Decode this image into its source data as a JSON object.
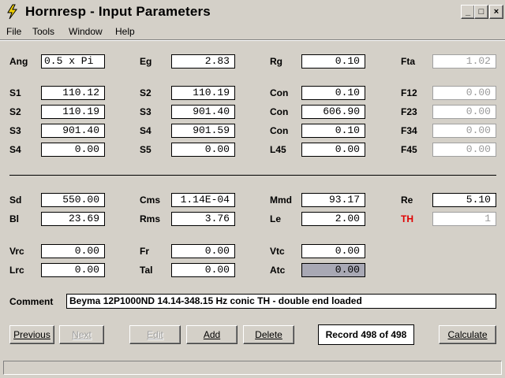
{
  "window": {
    "title": "Hornresp - Input Parameters",
    "minimize": "_",
    "maximize": "□",
    "close": "×"
  },
  "menu": [
    "File",
    "Tools",
    "Window",
    "Help"
  ],
  "params": {
    "Ang": "0.5 x Pi",
    "Eg": "2.83",
    "Rg": "0.10",
    "Fta": "1.02",
    "S1": "110.12",
    "S2a": "110.19",
    "Con1": "0.10",
    "F12": "0.00",
    "S2b": "110.19",
    "S3a": "901.40",
    "Con2": "606.90",
    "F23": "0.00",
    "S3b": "901.40",
    "S4a": "901.59",
    "Con3": "0.10",
    "F34": "0.00",
    "S4b": "0.00",
    "S5": "0.00",
    "L45": "0.00",
    "F45": "0.00",
    "Sd": "550.00",
    "Cms": "1.14E-04",
    "Mmd": "93.17",
    "Re": "5.10",
    "Bl": "23.69",
    "Rms": "3.76",
    "Le": "2.00",
    "TH": "1",
    "Vrc": "0.00",
    "Fr": "0.00",
    "Vtc": "0.00",
    "Lrc": "0.00",
    "Tal": "0.00",
    "Atc": "0.00"
  },
  "labels": {
    "Ang": "Ang",
    "Eg": "Eg",
    "Rg": "Rg",
    "Fta": "Fta",
    "S1": "S1",
    "S2": "S2",
    "S3": "S3",
    "S4": "S4",
    "S5": "S5",
    "Con": "Con",
    "L45": "L45",
    "F12": "F12",
    "F23": "F23",
    "F34": "F34",
    "F45": "F45",
    "Sd": "Sd",
    "Cms": "Cms",
    "Mmd": "Mmd",
    "Re": "Re",
    "Bl": "Bl",
    "Rms": "Rms",
    "Le": "Le",
    "TH": "TH",
    "Vrc": "Vrc",
    "Fr": "Fr",
    "Vtc": "Vtc",
    "Lrc": "Lrc",
    "Tal": "Tal",
    "Atc": "Atc",
    "Comment": "Comment"
  },
  "comment": "Beyma 12P1000ND 14.14-348.15 Hz conic TH - double end loaded",
  "buttons": {
    "previous": "Previous",
    "next": "Next",
    "edit": "Edit",
    "add": "Add",
    "delete": "Delete",
    "calculate": "Calculate"
  },
  "record": "Record 498 of 498",
  "colors": {
    "th_label": "#e00000",
    "disabled_text": "#9a9a9a",
    "selected_field": "#a8a8b4"
  }
}
